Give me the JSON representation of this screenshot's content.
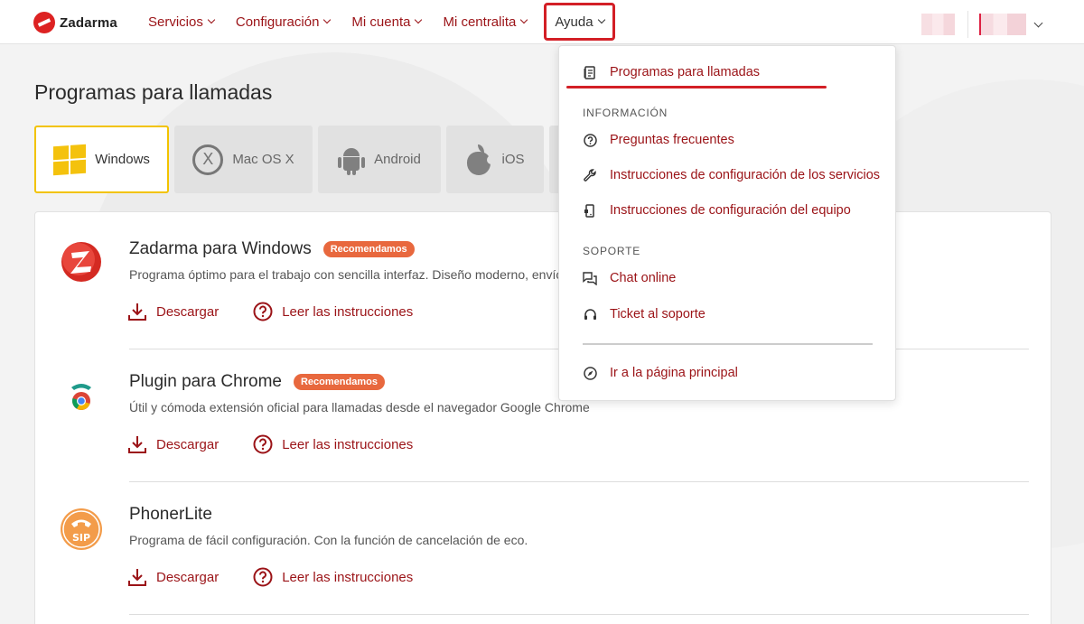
{
  "header": {
    "brand": "Zadarma",
    "nav": [
      {
        "label": "Servicios"
      },
      {
        "label": "Configuración"
      },
      {
        "label": "Mi cuenta"
      },
      {
        "label": "Mi centralita"
      },
      {
        "label": "Ayuda"
      }
    ]
  },
  "page": {
    "title": "Programas para llamadas",
    "os_tabs": [
      {
        "label": "Windows",
        "icon": "windows-icon",
        "active": true
      },
      {
        "label": "Mac OS X",
        "icon": "macos-icon"
      },
      {
        "label": "Android",
        "icon": "android-icon"
      },
      {
        "label": "iOS",
        "icon": "apple-icon"
      }
    ],
    "programs": [
      {
        "title": "Zadarma para Windows",
        "badge": "Recomendamos",
        "desc": "Programa óptimo para el trabajo con sencilla interfaz. Diseño moderno, envío",
        "download": "Descargar",
        "instructions": "Leer las instrucciones"
      },
      {
        "title": "Plugin para Chrome",
        "badge": "Recomendamos",
        "desc": "Útil y cómoda extensión oficial para llamadas desde el navegador Google Chrome",
        "download": "Descargar",
        "instructions": "Leer las instrucciones"
      },
      {
        "title": "PhonerLite",
        "desc": "Programa de fácil configuración. Con la función de cancelación de eco.",
        "download": "Descargar",
        "instructions": "Leer las instrucciones",
        "icon_text": "SIP"
      }
    ]
  },
  "dropdown": {
    "top_item": "Programas para llamadas",
    "section_info": "INFORMACIÓN",
    "info_items": [
      "Preguntas frecuentes",
      "Instrucciones de configuración de los servicios",
      "Instrucciones de configuración del equipo"
    ],
    "section_support": "SOPORTE",
    "support_items": [
      "Chat online",
      "Ticket al soporte"
    ],
    "home": "Ir a la página principal"
  },
  "colors": {
    "brand_red": "#9b1317",
    "highlight_red": "#d31f26",
    "badge_orange": "#e8683e",
    "windows_yellow": "#f4c20d"
  }
}
